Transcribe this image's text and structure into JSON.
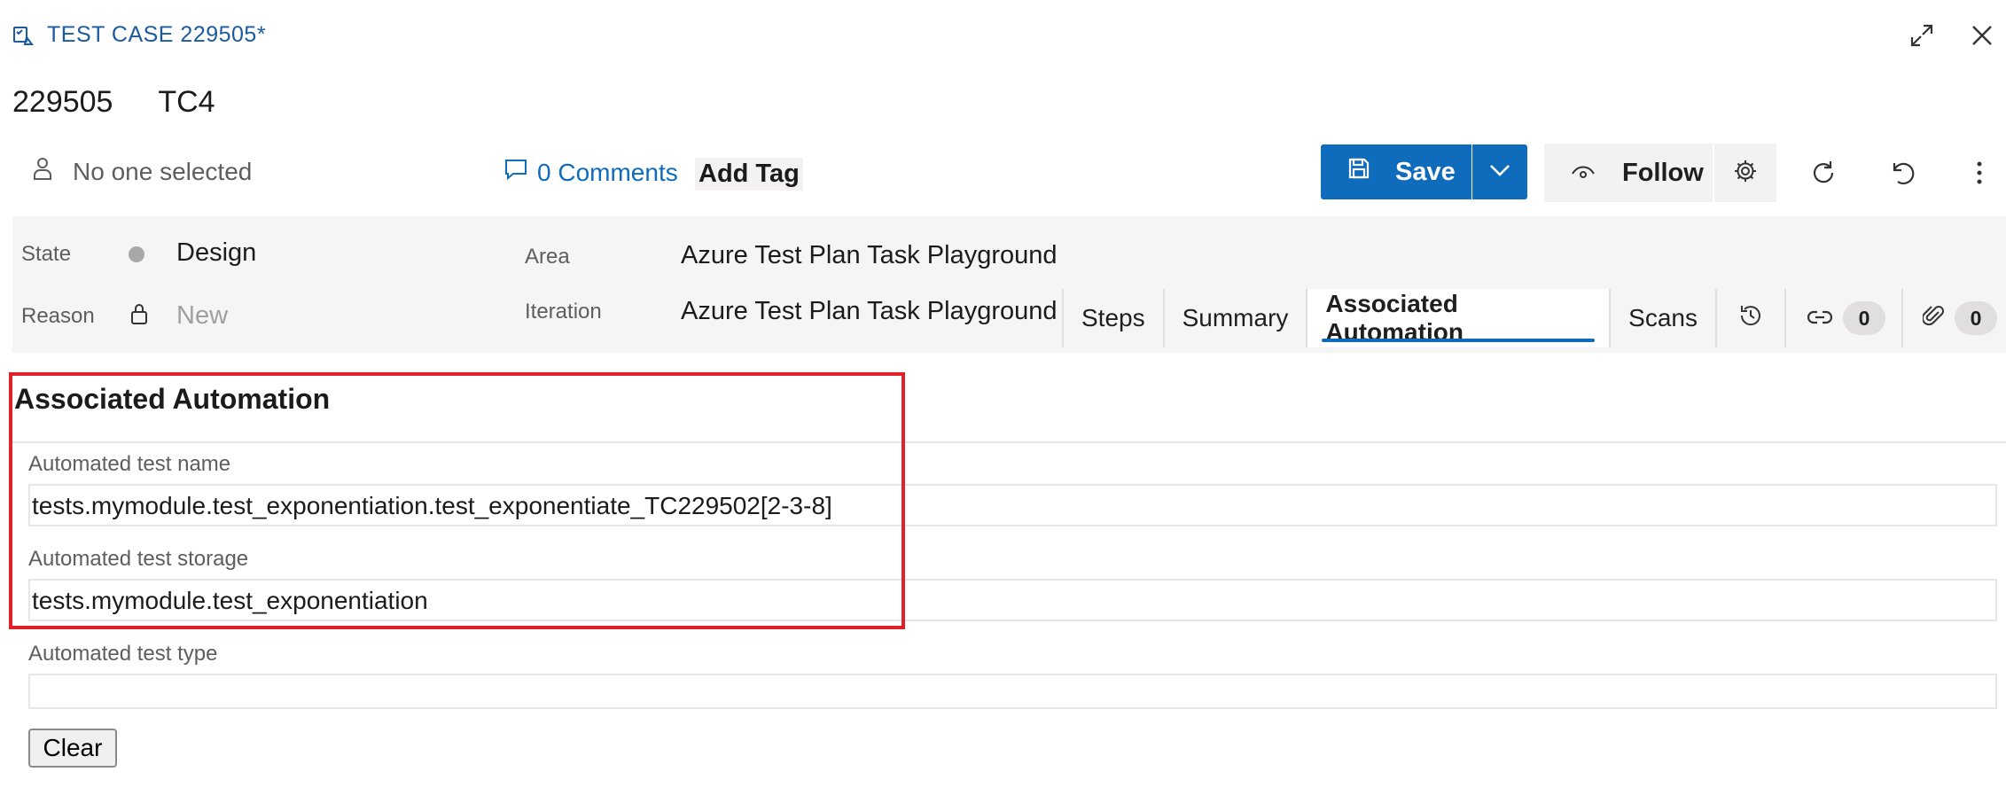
{
  "titlebar": {
    "label": "TEST CASE 229505*",
    "icons": [
      "test-case-icon",
      "expand-icon",
      "close-icon"
    ]
  },
  "work_item": {
    "id": "229505",
    "title": "TC4"
  },
  "header": {
    "assignee": "No one selected",
    "comments": "0 Comments",
    "add_tag": "Add Tag",
    "save_label": "Save",
    "follow_label": "Follow",
    "icons": [
      "person-icon",
      "comment-icon",
      "save-icon",
      "chevron-down-icon",
      "eye-icon",
      "gear-icon",
      "refresh-icon",
      "undo-icon",
      "more-icon"
    ]
  },
  "fields": {
    "state_label": "State",
    "state_value": "Design",
    "reason_label": "Reason",
    "reason_value": "New",
    "area_label": "Area",
    "area_value": "Azure Test Plan Task Playground",
    "iteration_label": "Iteration",
    "iteration_value": "Azure Test Plan Task Playground"
  },
  "tabs": {
    "items": [
      "Steps",
      "Summary",
      "Associated Automation",
      "Scans"
    ],
    "active": "Associated Automation",
    "links_count": "0",
    "attachments_count": "0"
  },
  "automation": {
    "section_title": "Associated Automation",
    "test_name_label": "Automated test name",
    "test_name_value": "tests.mymodule.test_exponentiation.test_exponentiate_TC229502[2-3-8]",
    "test_storage_label": "Automated test storage",
    "test_storage_value": "tests.mymodule.test_exponentiation",
    "test_type_label": "Automated test type",
    "test_type_value": "",
    "clear_label": "Clear"
  },
  "colors": {
    "accent": "#0f6cbd",
    "highlight": "#e0202a"
  }
}
